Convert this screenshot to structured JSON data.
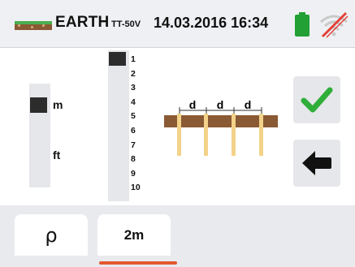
{
  "header": {
    "title": "EARTH",
    "subtitle": "TT-50V",
    "datetime": "14.03.2016 16:34",
    "battery_color": "#22a035",
    "wifi_status_icon": "wifi-disabled-icon"
  },
  "units": {
    "options": [
      "m",
      "ft"
    ],
    "selected": "m"
  },
  "distance": {
    "values": [
      "1",
      "2",
      "3",
      "4",
      "5",
      "6",
      "7",
      "8",
      "9",
      "10"
    ],
    "selected": "1"
  },
  "diagram": {
    "labels": [
      "d",
      "d",
      "d"
    ],
    "ground_color": "#8a5a34",
    "rod_color": "#f3d38a"
  },
  "actions": {
    "confirm_icon": "checkmark-icon",
    "confirm_color": "#2fae3a",
    "back_icon": "arrow-left-icon"
  },
  "tabs": [
    {
      "label": "ρ",
      "active": false
    },
    {
      "label": "2m",
      "active": true
    }
  ],
  "accent_color": "#e3572e"
}
